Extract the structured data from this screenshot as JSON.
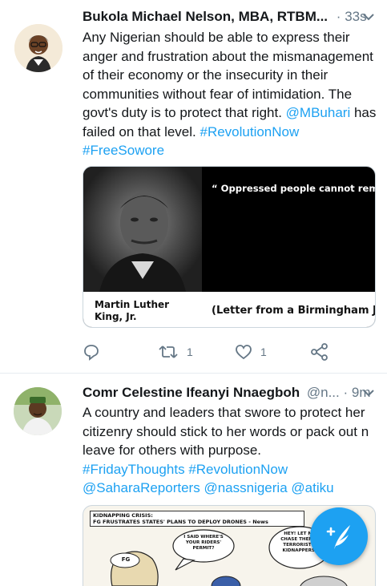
{
  "tweets": [
    {
      "name": "Bukola Michael Nelson, MBA, RTBM...",
      "handle": "",
      "dot": "·",
      "time": "33s",
      "text_parts": {
        "p1": "Any Nigerian should be able to express their anger and frustration about the mismanagement of their economy or the insecurity in their communities without fear of intimidation. The govt's duty is to protect that right. ",
        "mention": "@MBuhari",
        "p2": " has failed on that level. ",
        "tag1": "#RevolutionNow",
        "tag2": "#FreeSowore"
      },
      "quote_card": {
        "quote": "“ Oppressed people cannot remain oppressed forever. The yearning for freedom eventually manifests itself, and that is what has happened to the American Negro. Something within has reminded him of his birthright of freedom, and something without has reminded him that it can be gained.",
        "author": "Martin Luther King, Jr.",
        "source": "(Letter from a Birmingham Jail)"
      },
      "retweets": "1",
      "likes": "1"
    },
    {
      "name": "Comr Celestine Ifeanyi Nnaegboh",
      "handle": "@n...",
      "dot": "·",
      "time": "9m",
      "text": "A country and leaders that swore to protect her citizenry should stick to her words or pack out n leave for others with purpose.",
      "tags": {
        "t1": "#FridayThoughts",
        "t2": "#RevolutionNow",
        "m1": "@SaharaReporters",
        "m2": "@nassnigeria",
        "m3": "@atiku"
      },
      "cartoon": {
        "header": "KIDNAPPING CRISIS:",
        "subheader": "FG FRUSTRATES STATES' PLANS TO DEPLOY DRONES - News",
        "bubble1": "I SAID WHERE'S YOUR RIDERS' PERMIT?",
        "bubble2": "HEY! LET ME CHASE THEM!.. TERRORISTS, KIDNAPPERS!",
        "label": "FG"
      }
    }
  ],
  "colors": {
    "accent": "#1da1f2",
    "muted": "#657786",
    "text": "#14171a",
    "border": "#e6ecf0"
  },
  "icons": [
    "reply-icon",
    "retweet-icon",
    "like-icon",
    "share-icon",
    "chevron-down-icon",
    "compose-tweet-icon"
  ]
}
